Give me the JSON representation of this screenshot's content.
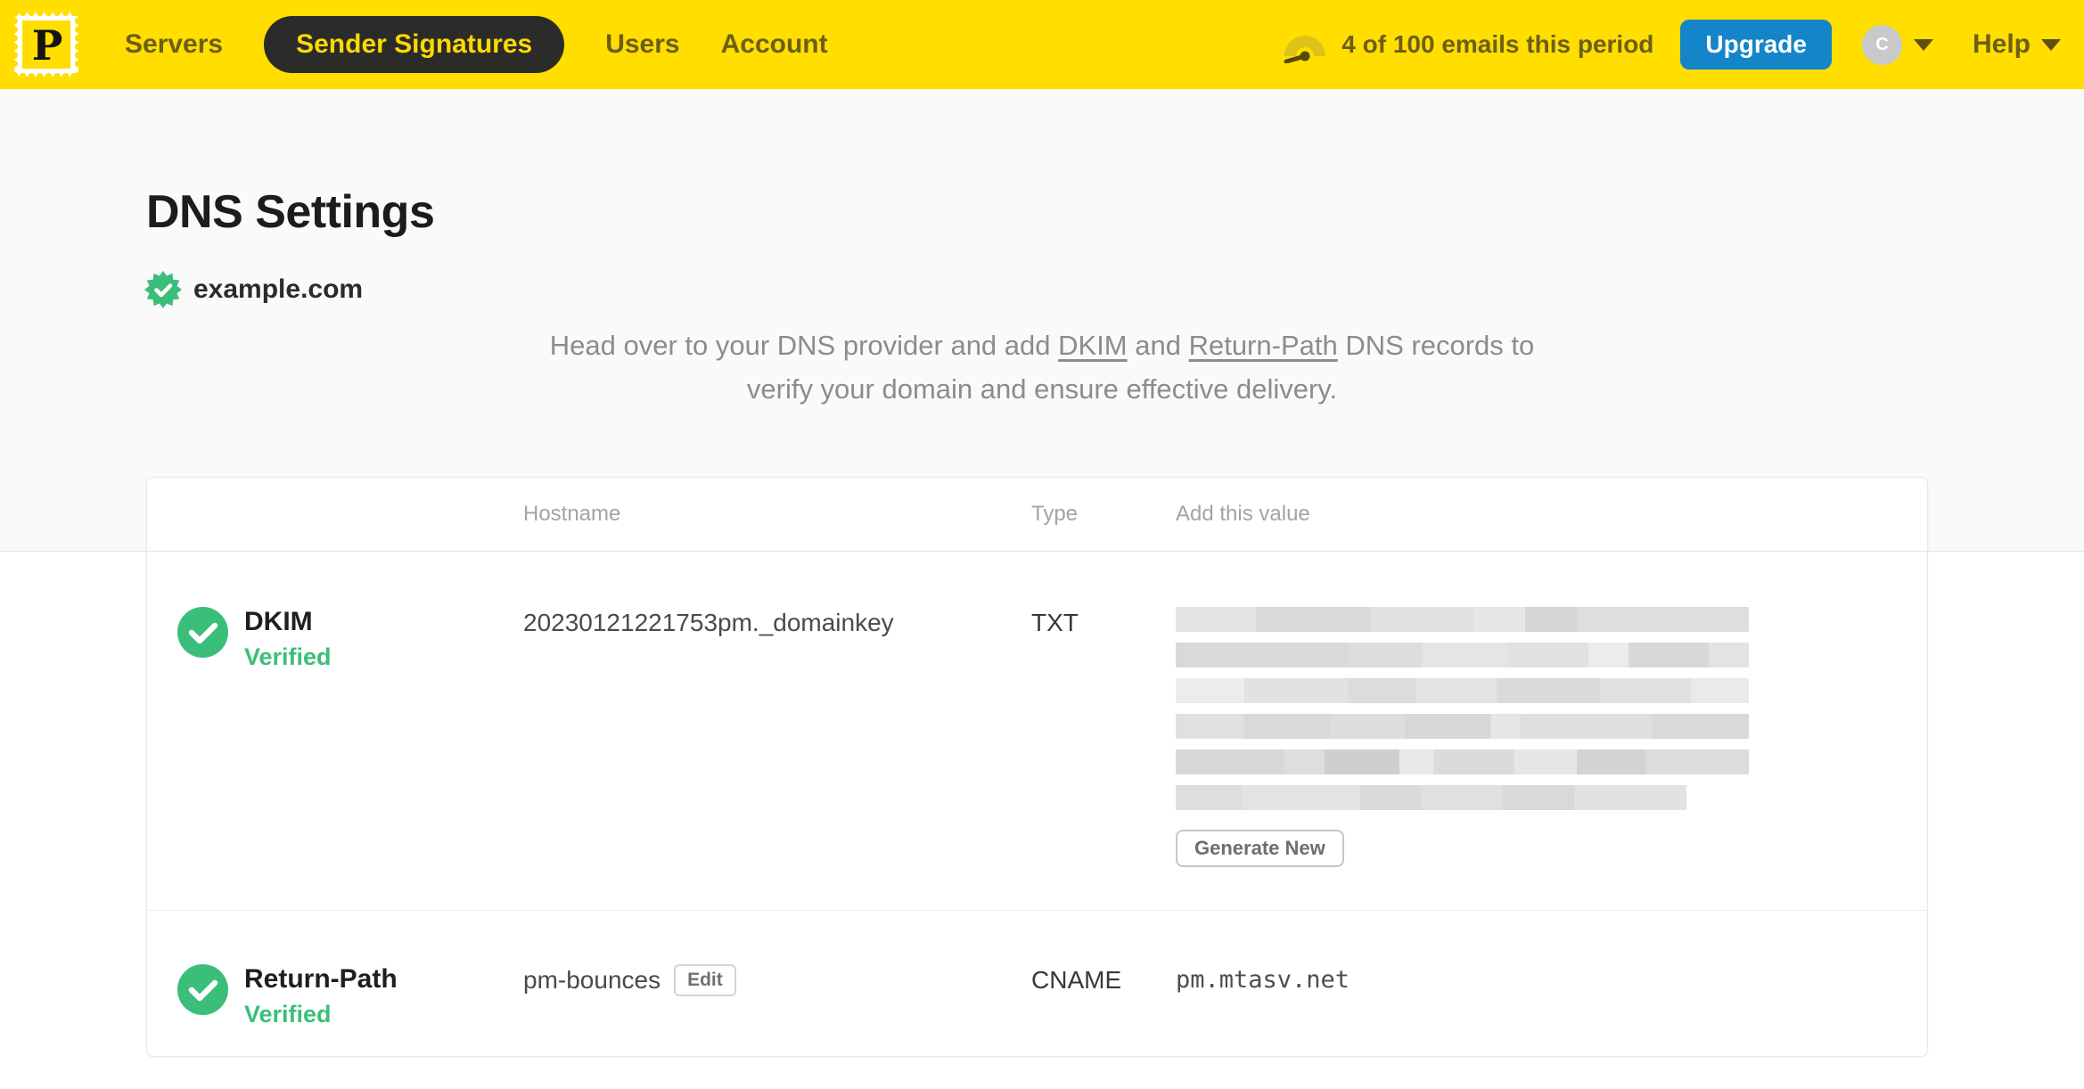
{
  "nav": {
    "logo_letter": "P",
    "items": [
      {
        "label": "Servers",
        "active": false
      },
      {
        "label": "Sender Signatures",
        "active": true
      },
      {
        "label": "Users",
        "active": false
      },
      {
        "label": "Account",
        "active": false
      }
    ],
    "usage_text": "4 of 100 emails this period",
    "upgrade_label": "Upgrade",
    "avatar_initial": "C",
    "help_label": "Help"
  },
  "page": {
    "title": "DNS Settings",
    "domain": "example.com",
    "intro": {
      "pre": "Head over to your DNS provider and add ",
      "link_dkim": "DKIM",
      "mid": " and ",
      "link_return_path": "Return-Path",
      "post_line1": " DNS records to",
      "post_line2": "verify your domain and ensure effective delivery."
    }
  },
  "dns_table": {
    "headers": {
      "hostname": "Hostname",
      "type": "Type",
      "value": "Add this value"
    },
    "rows": [
      {
        "name": "DKIM",
        "status": "Verified",
        "hostname": "20230121221753pm._domainkey",
        "type": "TXT",
        "value_redacted": true,
        "action_label": "Generate New"
      },
      {
        "name": "Return-Path",
        "status": "Verified",
        "hostname": "pm-bounces",
        "edit_label": "Edit",
        "type": "CNAME",
        "value": "pm.mtasv.net"
      }
    ]
  },
  "colors": {
    "brand_yellow": "#FFDE00",
    "nav_text_olive": "#6D5E16",
    "active_pill_bg": "#2B2B29",
    "upgrade_blue": "#1485C8",
    "verified_green": "#3CBE7B",
    "muted_text_gray": "#8C8C8C"
  }
}
